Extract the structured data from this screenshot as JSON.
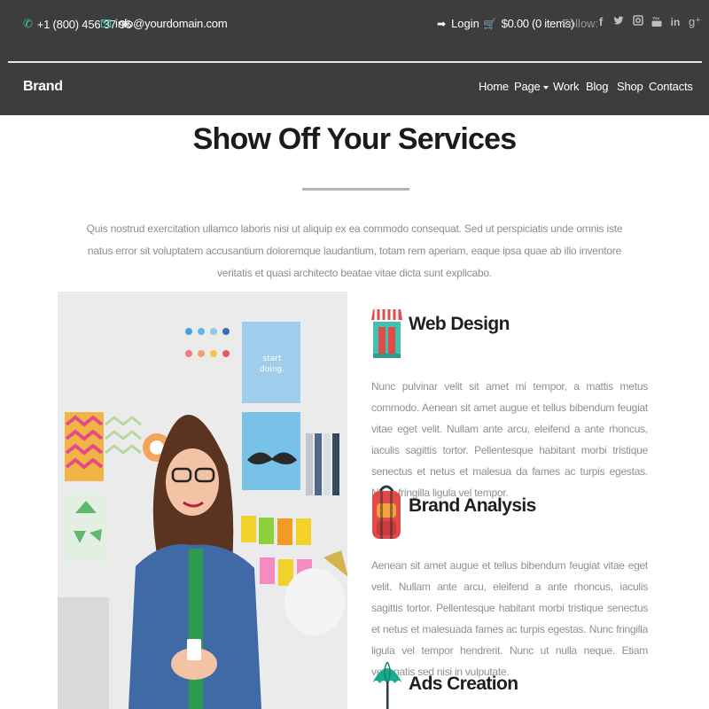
{
  "header": {
    "phone": "+1 (800) 456 37 96",
    "email": "info@yourdomain.com",
    "login_label": "Login",
    "cart_label": "$0.00 (0 items)",
    "follow_label": "Follow:",
    "social_icons": [
      "facebook-icon",
      "twitter-icon",
      "instagram-icon",
      "youtube-icon",
      "linkedin-icon",
      "google-plus-icon"
    ],
    "brand": "Brand",
    "nav": [
      "Home",
      "Page",
      "Work",
      "Blog",
      "Shop",
      "Contacts"
    ]
  },
  "main": {
    "title": "Show Off Your Services",
    "intro": "Quis nostrud exercitation ullamco laboris nisi ut aliquip ex ea commodo consequat. Sed ut perspiciatis unde omnis iste natus error sit voluptatem accusantium doloremque laudantium, totam rem aperiam, eaque ipsa quae ab illo inventore veritatis et quasi architecto beatae vitae dicta sunt explicabo.",
    "services": [
      {
        "icon": "storefront-icon",
        "title": "Web Design",
        "text": "Nunc pulvinar velit sit amet mi tempor, a mattis metus commodo. Aenean sit amet augue et tellus bibendum feugiat vitae eget velit. Nullam ante arcu, eleifend a ante rhoncus, iaculis sagittis tortor. Pellentesque habitant morbi tristique senectus et netus et malesua da fames ac turpis egestas. Nunc fringilla ligula vel tempor."
      },
      {
        "icon": "backpack-icon",
        "title": "Brand Analysis",
        "text": "Aenean sit amet augue et tellus bibendum feugiat vitae eget velit. Nullam ante arcu, eleifend a ante rhoncus, iaculis sagittis tortor. Pellentesque habitant morbi tristique senectus et netus et malesuada fames ac turpis egestas. Nunc fringilla ligula vel tempor hendrerit. Nunc ut nulla neque. Etiam venenatis sed nisi in vulputate."
      },
      {
        "icon": "umbrella-icon",
        "title": "Ads Creation"
      }
    ]
  },
  "colors": {
    "header_bg": "#3d3d3d",
    "accent": "#3fc2b0",
    "text_muted": "#8d8d8d"
  }
}
